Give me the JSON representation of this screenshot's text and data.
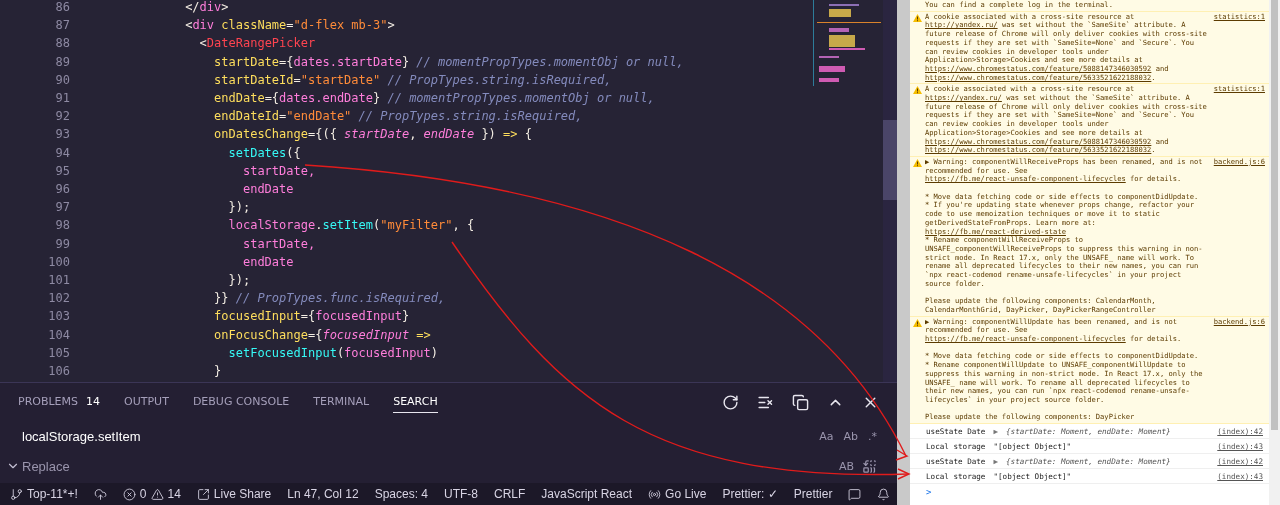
{
  "editor": {
    "lines": [
      {
        "number": "86",
        "tokens": [
          {
            "kind": "punct",
            "text": "              </"
          },
          {
            "kind": "tag",
            "text": "div"
          },
          {
            "kind": "punct",
            "text": ">"
          }
        ]
      },
      {
        "number": "87",
        "tokens": [
          {
            "kind": "punct",
            "text": "              <"
          },
          {
            "kind": "tag",
            "text": "div"
          },
          {
            "kind": "attr",
            "text": " className"
          },
          {
            "kind": "punct",
            "text": "="
          },
          {
            "kind": "str",
            "text": "\"d-flex mb-3\""
          },
          {
            "kind": "punct",
            "text": ">"
          }
        ]
      },
      {
        "number": "88",
        "tokens": [
          {
            "kind": "punct",
            "text": "                <"
          },
          {
            "kind": "comp",
            "text": "DateRangePicker"
          }
        ]
      },
      {
        "number": "89",
        "tokens": [
          {
            "kind": "attr",
            "text": "                  startDate"
          },
          {
            "kind": "punct",
            "text": "={"
          },
          {
            "kind": "var",
            "text": "dates.startDate"
          },
          {
            "kind": "punct",
            "text": "}"
          },
          {
            "kind": "comment",
            "text": " // momentPropTypes.momentObj or null,"
          }
        ]
      },
      {
        "number": "90",
        "tokens": [
          {
            "kind": "attr",
            "text": "                  startDateId"
          },
          {
            "kind": "punct",
            "text": "="
          },
          {
            "kind": "str",
            "text": "\"startDate\""
          },
          {
            "kind": "comment",
            "text": " // PropTypes.string.isRequired,"
          }
        ]
      },
      {
        "number": "91",
        "tokens": [
          {
            "kind": "attr",
            "text": "                  endDate"
          },
          {
            "kind": "punct",
            "text": "={"
          },
          {
            "kind": "var",
            "text": "dates.endDate"
          },
          {
            "kind": "punct",
            "text": "}"
          },
          {
            "kind": "comment",
            "text": " // momentPropTypes.momentObj or null,"
          }
        ]
      },
      {
        "number": "92",
        "tokens": [
          {
            "kind": "attr",
            "text": "                  endDateId"
          },
          {
            "kind": "punct",
            "text": "="
          },
          {
            "kind": "str",
            "text": "\"endDate\""
          },
          {
            "kind": "comment",
            "text": " // PropTypes.string.isRequired,"
          }
        ]
      },
      {
        "number": "93",
        "tokens": [
          {
            "kind": "attr",
            "text": "                  onDatesChange"
          },
          {
            "kind": "punct",
            "text": "={({ "
          },
          {
            "kind": "param",
            "text": "startDate"
          },
          {
            "kind": "punct",
            "text": ", "
          },
          {
            "kind": "param",
            "text": "endDate"
          },
          {
            "kind": "punct",
            "text": " }) "
          },
          {
            "kind": "kw",
            "text": "=>"
          },
          {
            "kind": "punct",
            "text": " {"
          }
        ]
      },
      {
        "number": "94",
        "tokens": [
          {
            "kind": "func",
            "text": "                    setDates"
          },
          {
            "kind": "punct",
            "text": "({"
          }
        ]
      },
      {
        "number": "95",
        "tokens": [
          {
            "kind": "var",
            "text": "                      startDate,"
          }
        ]
      },
      {
        "number": "96",
        "tokens": [
          {
            "kind": "var",
            "text": "                      endDate"
          }
        ]
      },
      {
        "number": "97",
        "tokens": [
          {
            "kind": "punct",
            "text": "                    });"
          }
        ]
      },
      {
        "number": "98",
        "tokens": [
          {
            "kind": "var",
            "text": "                    localStorage"
          },
          {
            "kind": "punct",
            "text": "."
          },
          {
            "kind": "func",
            "text": "setItem"
          },
          {
            "kind": "punct",
            "text": "("
          },
          {
            "kind": "str",
            "text": "\"myFilter\""
          },
          {
            "kind": "punct",
            "text": ", {"
          }
        ]
      },
      {
        "number": "99",
        "tokens": [
          {
            "kind": "var",
            "text": "                      startDate,"
          }
        ]
      },
      {
        "number": "100",
        "tokens": [
          {
            "kind": "var",
            "text": "                      endDate"
          }
        ]
      },
      {
        "number": "101",
        "tokens": [
          {
            "kind": "punct",
            "text": "                    });"
          }
        ]
      },
      {
        "number": "102",
        "tokens": [
          {
            "kind": "punct",
            "text": "                  }}"
          },
          {
            "kind": "comment",
            "text": " // PropTypes.func.isRequired,"
          }
        ]
      },
      {
        "number": "103",
        "tokens": [
          {
            "kind": "attr",
            "text": "                  focusedInput"
          },
          {
            "kind": "punct",
            "text": "={"
          },
          {
            "kind": "var",
            "text": "focusedInput"
          },
          {
            "kind": "punct",
            "text": "}"
          }
        ]
      },
      {
        "number": "104",
        "tokens": [
          {
            "kind": "attr",
            "text": "                  onFocusChange"
          },
          {
            "kind": "punct",
            "text": "={"
          },
          {
            "kind": "param",
            "text": "focusedInput"
          },
          {
            "kind": "kw",
            "text": " =>"
          }
        ]
      },
      {
        "number": "105",
        "tokens": [
          {
            "kind": "func",
            "text": "                    setFocusedInput"
          },
          {
            "kind": "punct",
            "text": "("
          },
          {
            "kind": "var",
            "text": "focusedInput"
          },
          {
            "kind": "punct",
            "text": ")"
          }
        ]
      },
      {
        "number": "106",
        "tokens": [
          {
            "kind": "punct",
            "text": "                  }"
          }
        ]
      }
    ]
  },
  "panel": {
    "tabs": [
      {
        "label": "PROBLEMS",
        "badge": "14",
        "selected": false
      },
      {
        "label": "OUTPUT",
        "selected": false
      },
      {
        "label": "DEBUG CONSOLE",
        "selected": false
      },
      {
        "label": "TERMINAL",
        "selected": false
      },
      {
        "label": "SEARCH",
        "selected": true
      }
    ],
    "search": {
      "value": "localStorage.setItem",
      "options": [
        {
          "label": "Aa",
          "selected": false
        },
        {
          "label": "Ab",
          "selected": false
        },
        {
          "label": ".*",
          "selected": false
        }
      ]
    },
    "replace": {
      "placeholder": "Replace",
      "options": [
        {
          "label": "AB",
          "selected": false
        }
      ]
    }
  },
  "status_bar": {
    "left": [
      {
        "kind": "branch",
        "text": "Top-11*+!"
      },
      {
        "kind": "sync"
      },
      {
        "kind": "problems",
        "errors": "0",
        "warnings": "14"
      },
      {
        "kind": "share",
        "text": "Live Share"
      }
    ],
    "right": [
      {
        "kind": "text",
        "text": "Ln 47, Col 12"
      },
      {
        "kind": "text",
        "text": "Spaces: 4"
      },
      {
        "kind": "text",
        "text": "UTF-8"
      },
      {
        "kind": "text",
        "text": "CRLF"
      },
      {
        "kind": "text",
        "text": "JavaScript React"
      },
      {
        "kind": "live",
        "text": "Go Live"
      },
      {
        "kind": "text",
        "text": "Prettier: ✓"
      },
      {
        "kind": "text",
        "text": "Prettier"
      },
      {
        "kind": "feedback"
      },
      {
        "kind": "bell"
      }
    ]
  },
  "console": {
    "messages": [
      {
        "kind": "note",
        "parts": [
          {
            "kind": "text",
            "text": "You can find a complete log in the terminal."
          }
        ]
      },
      {
        "kind": "warning",
        "source": "statistics:1",
        "parts": [
          {
            "kind": "text",
            "text": "A cookie associated with a cross-site resource at "
          },
          {
            "kind": "link",
            "text": "http://yandex.ru/"
          },
          {
            "kind": "text",
            "text": " was set without the `SameSite` attribute. A future release of Chrome will only deliver cookies with cross-site requests if they are set with `SameSite=None` and `Secure`. You can review cookies in developer tools under Application>Storage>Cookies and see more details at "
          },
          {
            "kind": "link",
            "text": "https://www.chromestatus.com/feature/5088147346030592"
          },
          {
            "kind": "text",
            "text": " and "
          },
          {
            "kind": "link",
            "text": "https://www.chromestatus.com/feature/5633521622188032"
          },
          {
            "kind": "text",
            "text": "."
          }
        ]
      },
      {
        "kind": "warning",
        "source": "statistics:1",
        "parts": [
          {
            "kind": "text",
            "text": "A cookie associated with a cross-site resource at "
          },
          {
            "kind": "link",
            "text": "https://yandex.ru/"
          },
          {
            "kind": "text",
            "text": " was set without the `SameSite` attribute. A future release of Chrome will only deliver cookies with cross-site requests if they are set with `SameSite=None` and `Secure`. You can review cookies in developer tools under Application>Storage>Cookies and see more details at "
          },
          {
            "kind": "link",
            "text": "https://www.chromestatus.com/feature/5088147346030592"
          },
          {
            "kind": "text",
            "text": " and "
          },
          {
            "kind": "link",
            "text": "https://www.chromestatus.com/feature/5633521622188032"
          },
          {
            "kind": "text",
            "text": "."
          }
        ]
      },
      {
        "kind": "warning",
        "toggle": "▶",
        "source": "backend.js:6",
        "parts": [
          {
            "kind": "text",
            "text": "Warning: componentWillReceiveProps has been renamed, and is not recommended for use. See "
          },
          {
            "kind": "link",
            "text": "https://fb.me/react-unsafe-component-lifecycles"
          },
          {
            "kind": "text",
            "text": " for details.\n\n* Move data fetching code or side effects to componentDidUpdate.\n* If you're updating state whenever props change, refactor your code to use memoization techniques or move it to static getDerivedStateFromProps. Learn more at: "
          },
          {
            "kind": "link",
            "text": "https://fb.me/react-derived-state"
          },
          {
            "kind": "text",
            "text": "\n* Rename componentWillReceiveProps to UNSAFE_componentWillReceiveProps to suppress this warning in non-strict mode. In React 17.x, only the UNSAFE_ name will work. To rename all deprecated lifecycles to their new names, you can run `npx react-codemod rename-unsafe-lifecycles` in your project source folder.\n\nPlease update the following components: CalendarMonth, CalendarMonthGrid, DayPicker, DayPickerRangeController"
          }
        ]
      },
      {
        "kind": "warning",
        "toggle": "▶",
        "source": "backend.js:6",
        "parts": [
          {
            "kind": "text",
            "text": "Warning: componentWillUpdate has been renamed, and is not recommended for use. See "
          },
          {
            "kind": "link",
            "text": "https://fb.me/react-unsafe-component-lifecycles"
          },
          {
            "kind": "text",
            "text": " for details.\n\n* Move data fetching code or side effects to componentDidUpdate.\n* Rename componentWillUpdate to UNSAFE_componentWillUpdate to suppress this warning in non-strict mode. In React 17.x, only the UNSAFE_ name will work. To rename all deprecated lifecycles to their new names, you can run `npx react-codemod rename-unsafe-lifecycles` in your project source folder.\n\nPlease update the following components: DayPicker"
          }
        ]
      },
      {
        "kind": "log",
        "label": "useState Date",
        "toggle": "▶",
        "value": "{startDate: Moment, endDate: Moment}",
        "source": "(index):42"
      },
      {
        "kind": "log",
        "label": "Local storage",
        "value": "\"[object Object]\"",
        "source": "(index):43"
      },
      {
        "kind": "log",
        "label": "useState Date",
        "toggle": "▶",
        "value": "{startDate: Moment, endDate: Moment}",
        "source": "(index):42"
      },
      {
        "kind": "log",
        "label": "Local storage",
        "value": "\"[object Object]\"",
        "source": "(index):43"
      }
    ],
    "prompt": ">"
  }
}
